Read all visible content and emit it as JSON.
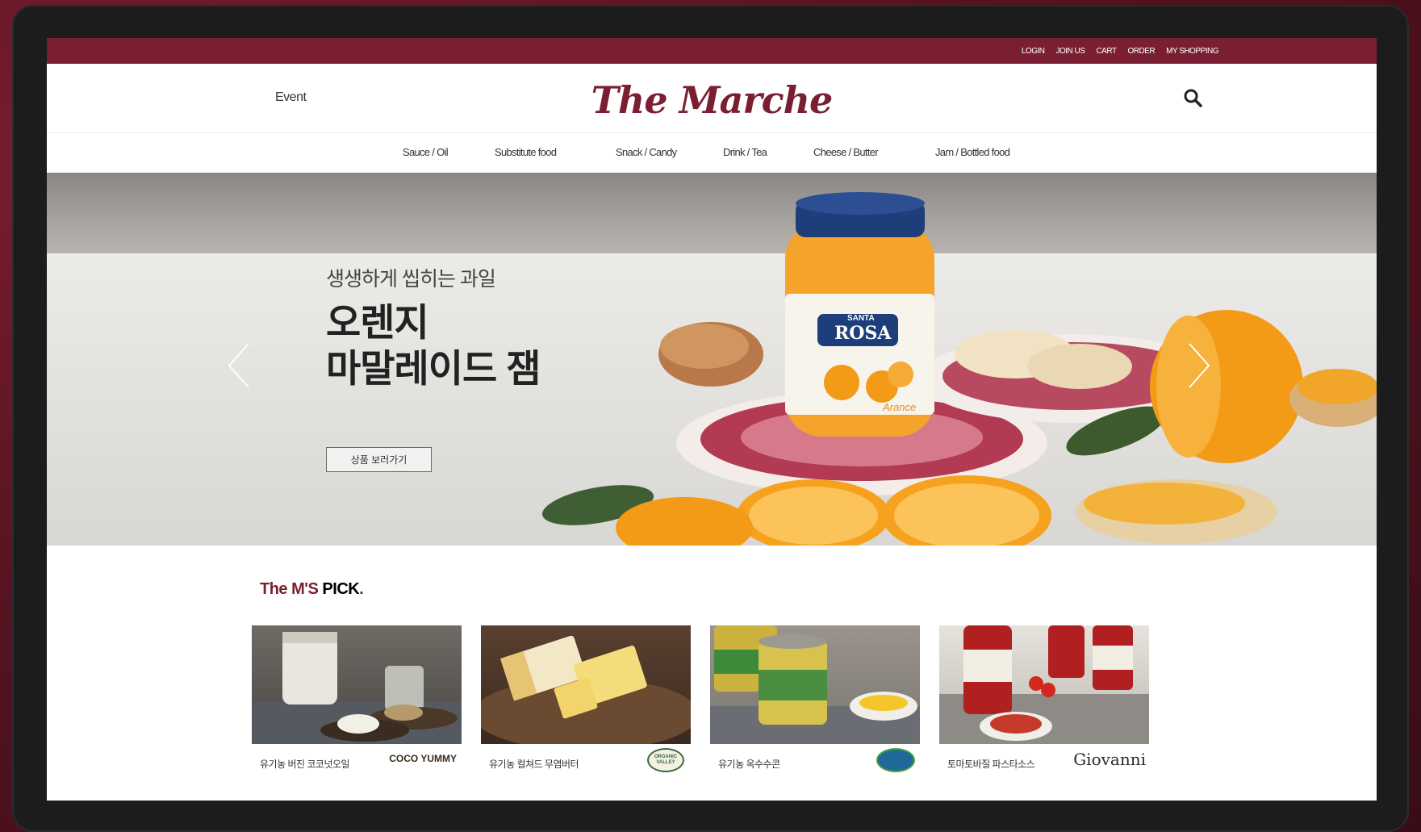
{
  "topbar": {
    "links": [
      "LOGIN",
      "JOIN US",
      "CART",
      "ORDER",
      "MY SHOPPING"
    ]
  },
  "header": {
    "event": "Event",
    "logo": "The Marche"
  },
  "nav": {
    "items": [
      "Sauce / Oil",
      "Substitute food",
      "Snack / Candy",
      "Drink / Tea",
      "Cheese / Butter",
      "Jam / Bottled food"
    ]
  },
  "hero": {
    "subtitle": "생생하게 씹히는 과일",
    "title": "오렌지\n마말레이드 잼",
    "cta": "상품 보러가기",
    "jar_brand_top": "SANTA",
    "jar_brand": "ROSA",
    "jar_flavor": "Arance"
  },
  "pick": {
    "title_a": "The M'S",
    "title_b": " PICK",
    "title_dot": ".",
    "items": [
      {
        "label": "유기농 버진 코코넛오일",
        "brand": "COCO YUMMY"
      },
      {
        "label": "유기농 컬쳐드 무염버터",
        "brand": "ORGANIC VALLEY"
      },
      {
        "label": "유기농 옥수수콘",
        "brand": ""
      },
      {
        "label": "토마토바질 파스타소스",
        "brand": "Giovanni"
      }
    ]
  },
  "colors": {
    "brand": "#7a1f31",
    "bezel": "#1c1c1c",
    "orange": "#f39a16"
  }
}
